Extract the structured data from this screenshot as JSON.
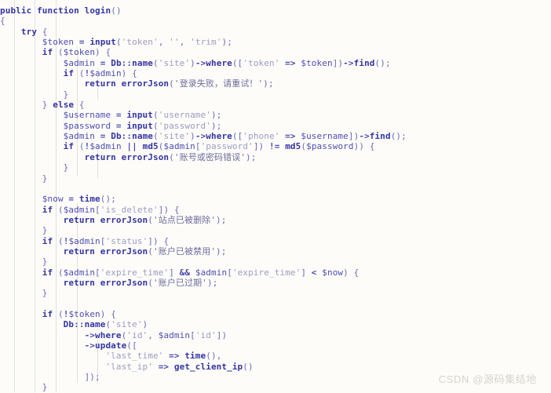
{
  "viewer": {
    "name": "code-snippet-viewer",
    "background_color": "#fdfcf9",
    "language": "php",
    "font_size_px": 11,
    "line_height_px": 13.35,
    "indent_guides": true,
    "guide_color": "#e2e0dc"
  },
  "colors": {
    "keyword": "#3434a4",
    "variable": "#4d4db5",
    "string": "#9c9cc4",
    "chinese_string": "#6e6e9e",
    "operator": "#4a4ab0",
    "punctuation": "#6a6ab8",
    "watermark": "#d8d4cc"
  },
  "watermark": {
    "text": "CSDN @源码集结地"
  },
  "code": {
    "lines": [
      "public function login()",
      "{",
      "    try {",
      "        $token = input('token', '', 'trim');",
      "        if ($token) {",
      "            $admin = Db::name('site')->where(['token' => $token])->find();",
      "            if (!$admin) {",
      "                return errorJson('登录失败，请重试！');",
      "            }",
      "        } else {",
      "            $username = input('username');",
      "            $password = input('password');",
      "            $admin = Db::name('site')->where(['phone' => $username])->find();",
      "            if (!$admin || md5($admin['password']) != md5($password)) {",
      "                return errorJson('账号或密码错误');",
      "            }",
      "        }",
      "",
      "        $now = time();",
      "        if ($admin['is_delete']) {",
      "            return errorJson('站点已被删除');",
      "        }",
      "        if (!$admin['status']) {",
      "            return errorJson('账户已被禁用');",
      "        }",
      "        if ($admin['expire_time'] && $admin['expire_time'] < $now) {",
      "            return errorJson('账户已过期');",
      "        }",
      "",
      "        if (!$token) {",
      "            Db::name('site')",
      "                ->where('id', $admin['id'])",
      "                ->update([",
      "                    'last_time' => time(),",
      "                    'last_ip' => get_client_ip()",
      "                ]);",
      "        }"
    ],
    "tokens": {
      "keywords": [
        "public",
        "function",
        "try",
        "if",
        "else",
        "return"
      ],
      "functions": [
        "login",
        "input",
        "errorJson",
        "find",
        "where",
        "update",
        "md5",
        "time",
        "get_client_ip",
        "name"
      ],
      "variables": [
        "$token",
        "$admin",
        "$username",
        "$password",
        "$now"
      ],
      "classes": [
        "Db"
      ],
      "strings": [
        "'token'",
        "''",
        "'trim'",
        "'site'",
        "'username'",
        "'password'",
        "'phone'",
        "'is_delete'",
        "'status'",
        "'expire_time'",
        "'id'",
        "'last_time'",
        "'last_ip'"
      ],
      "chinese_strings": [
        "'登录失败，请重试！'",
        "'账号或密码错误'",
        "'站点已被删除'",
        "'账户已被禁用'",
        "'账户已过期'"
      ],
      "operators": [
        "=",
        "=>",
        "!",
        "||",
        "!=",
        "&&",
        "<",
        "->",
        "::"
      ]
    },
    "indent_guide_columns": [
      1,
      2,
      3,
      4,
      5
    ]
  }
}
